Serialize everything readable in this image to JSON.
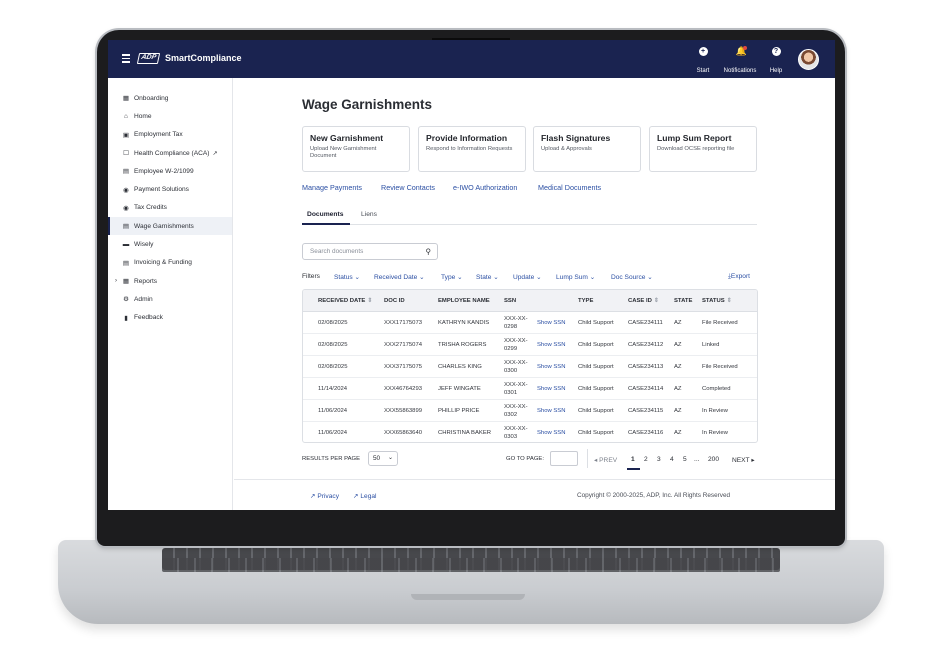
{
  "app": {
    "logo": "ADP",
    "name": "SmartCompliance"
  },
  "header_actions": [
    {
      "icon": "plus-circle-icon",
      "label": "Start"
    },
    {
      "icon": "bell-icon",
      "label": "Notifications"
    },
    {
      "icon": "help-circle-icon",
      "label": "Help"
    }
  ],
  "sidebar": {
    "items": [
      {
        "icon": "grid-icon",
        "label": "Onboarding"
      },
      {
        "icon": "home-icon",
        "label": "Home"
      },
      {
        "icon": "briefcase-icon",
        "label": "Employment Tax"
      },
      {
        "icon": "clipboard-icon",
        "label": "Health Compliance (ACA)",
        "external": true
      },
      {
        "icon": "document-icon",
        "label": "Employee W-2/1099"
      },
      {
        "icon": "payment-icon",
        "label": "Payment Solutions"
      },
      {
        "icon": "dollar-icon",
        "label": "Tax Credits"
      },
      {
        "icon": "document-icon",
        "label": "Wage Garnishments",
        "active": true
      },
      {
        "icon": "card-icon",
        "label": "Wisely"
      },
      {
        "icon": "document-icon",
        "label": "Invoicing & Funding"
      },
      {
        "icon": "reports-icon",
        "label": "Reports",
        "expandable": true
      },
      {
        "icon": "gear-icon",
        "label": "Admin"
      },
      {
        "icon": "feedback-icon",
        "label": "Feedback"
      }
    ]
  },
  "page": {
    "title": "Wage Garnishments"
  },
  "cards": [
    {
      "title": "New Garnishment",
      "desc": "Upload New Garnishment Document"
    },
    {
      "title": "Provide Information",
      "desc": "Respond to Information Requests"
    },
    {
      "title": "Flash Signatures",
      "desc": "Upload & Approvals"
    },
    {
      "title": "Lump Sum Report",
      "desc": "Download OCSE reporting file"
    }
  ],
  "quick_links": [
    "Manage Payments",
    "Review Contacts",
    "e-IWO Authorization",
    "Medical Documents"
  ],
  "tabs": [
    {
      "label": "Documents",
      "active": true
    },
    {
      "label": "Liens"
    }
  ],
  "search": {
    "placeholder": "Search documents"
  },
  "filters": {
    "label": "Filters",
    "items": [
      "Status",
      "Received Date",
      "Type",
      "State",
      "Update",
      "Lump Sum",
      "Doc Source"
    ],
    "export": "Export"
  },
  "table": {
    "columns": [
      "RECEIVED DATE",
      "DOC ID",
      "EMPLOYEE NAME",
      "SSN",
      "TYPE",
      "CASE ID",
      "STATE",
      "STATUS"
    ],
    "show_ssn_label": "Show SSN",
    "rows": [
      {
        "date": "02/08/2025",
        "doc": "XXX17175073",
        "name": "KATHRYN KANDIS",
        "ssn": "XXX-XX-0298",
        "type": "Child Support",
        "case": "CASE234111",
        "state": "AZ",
        "status": "File Received"
      },
      {
        "date": "02/08/2025",
        "doc": "XXX27175074",
        "name": "TRISHA ROGERS",
        "ssn": "XXX-XX-0299",
        "type": "Child Support",
        "case": "CASE234112",
        "state": "AZ",
        "status": "Linked"
      },
      {
        "date": "02/08/2025",
        "doc": "XXX37175075",
        "name": "CHARLES KING",
        "ssn": "XXX-XX-0300",
        "type": "Child Support",
        "case": "CASE234113",
        "state": "AZ",
        "status": "File Received"
      },
      {
        "date": "11/14/2024",
        "doc": "XXX46764293",
        "name": "JEFF WINGATE",
        "ssn": "XXX-XX-0301",
        "type": "Child Support",
        "case": "CASE234114",
        "state": "AZ",
        "status": "Completed"
      },
      {
        "date": "11/06/2024",
        "doc": "XXX55863899",
        "name": "PHILLIP PRICE",
        "ssn": "XXX-XX-0302",
        "type": "Child Support",
        "case": "CASE234115",
        "state": "AZ",
        "status": "In Review"
      },
      {
        "date": "11/06/2024",
        "doc": "XXX65863640",
        "name": "CHRISTINA BAKER",
        "ssn": "XXX-XX-0303",
        "type": "Child Support",
        "case": "CASE234116",
        "state": "AZ",
        "status": "In Review"
      }
    ]
  },
  "pagination": {
    "results_label": "RESULTS PER PAGE",
    "per_page": "50",
    "goto_label": "GO TO PAGE:",
    "prev": "PREV",
    "pages": [
      "1",
      "2",
      "3",
      "4",
      "5",
      "...",
      "200"
    ],
    "current_page": "1",
    "next": "NEXT"
  },
  "footer": {
    "privacy": "Privacy",
    "legal": "Legal",
    "copyright": "Copyright © 2000-2025, ADP, Inc. All Rights Reserved"
  },
  "colors": {
    "header_bg": "#1a2350",
    "link": "#2b4fa3",
    "badge_red": "#e0483e"
  }
}
